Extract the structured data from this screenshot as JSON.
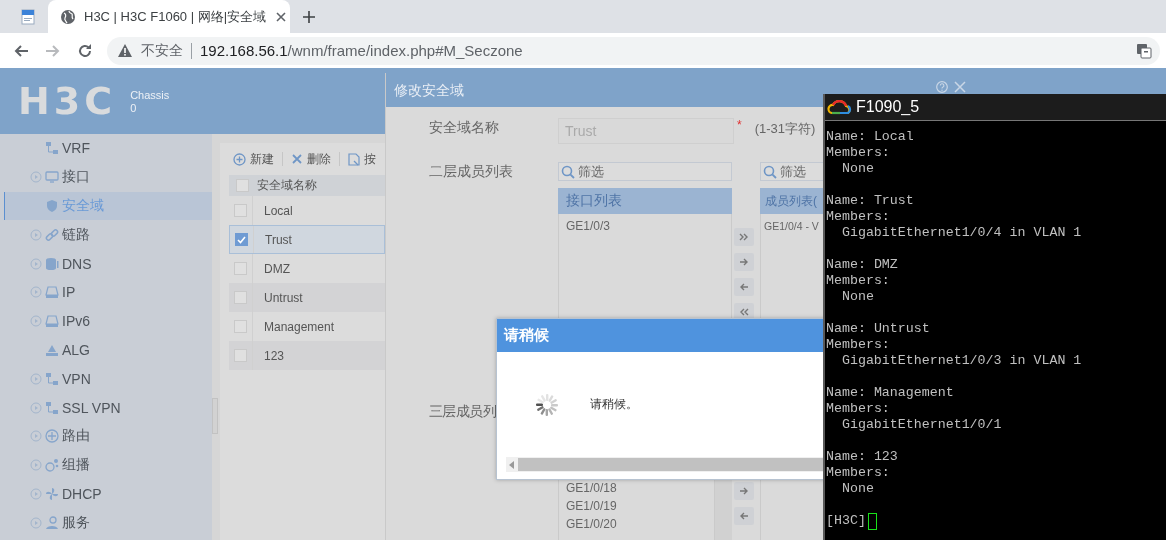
{
  "browser": {
    "tabs": [
      {
        "kind": "pinned",
        "selected": false
      },
      {
        "kind": "page",
        "title": "H3C | H3C F1060 | 网络|安全域",
        "selected": true
      }
    ],
    "nav": [
      {
        "kind": "back",
        "disabled": false
      },
      {
        "kind": "forward",
        "disabled": true
      },
      {
        "kind": "reload",
        "disabled": false
      }
    ],
    "address": {
      "security": "不安全",
      "url_host": "192.168.56.1",
      "url_path": "/wnm/frame/index.php#M_Seczone"
    }
  },
  "header": {
    "logo": "H3C",
    "device_label": "Chassis",
    "device_value": "0"
  },
  "sidebar": {
    "items": [
      {
        "label": "VRF",
        "expandable": false,
        "selected": false
      },
      {
        "label": "接口",
        "expandable": true,
        "selected": false
      },
      {
        "label": "安全域",
        "expandable": false,
        "selected": true
      },
      {
        "label": "链路",
        "expandable": true,
        "selected": false
      },
      {
        "label": "DNS",
        "expandable": true,
        "selected": false
      },
      {
        "label": "IP",
        "expandable": true,
        "selected": false
      },
      {
        "label": "IPv6",
        "expandable": true,
        "selected": false
      },
      {
        "label": "ALG",
        "expandable": false,
        "selected": false
      },
      {
        "label": "VPN",
        "expandable": true,
        "selected": false
      },
      {
        "label": "SSL VPN",
        "expandable": true,
        "selected": false
      },
      {
        "label": "路由",
        "expandable": true,
        "selected": false
      },
      {
        "label": "组播",
        "expandable": true,
        "selected": false
      },
      {
        "label": "DHCP",
        "expandable": true,
        "selected": false
      },
      {
        "label": "服务",
        "expandable": true,
        "selected": false
      }
    ]
  },
  "zone_list": {
    "toolbar": [
      {
        "kind": "add",
        "label": "新建"
      },
      {
        "kind": "delete",
        "label": "删除"
      },
      {
        "kind": "page",
        "label": "按"
      }
    ],
    "header": {
      "label": "安全域名称",
      "checked": false
    },
    "rows": [
      {
        "name": "Local",
        "checked": false,
        "selected": false
      },
      {
        "name": "Trust",
        "checked": true,
        "selected": true
      },
      {
        "name": "DMZ",
        "checked": false,
        "selected": false
      },
      {
        "name": "Untrust",
        "checked": false,
        "selected": false
      },
      {
        "name": "Management",
        "checked": false,
        "selected": false
      },
      {
        "name": "123",
        "checked": false,
        "selected": false
      }
    ]
  },
  "edit_dialog": {
    "title": "修改安全域",
    "name_label": "安全域名称",
    "name_value": "Trust",
    "name_disabled": true,
    "required_mark": "*",
    "name_hint": "(1-31字符)",
    "layer2": {
      "label": "二层成员列表",
      "filter_placeholder": "筛选",
      "available_header": "接口列表",
      "available": [
        "GE1/0/3"
      ],
      "member_filter_placeholder": "筛选",
      "member_header": "成员列表(",
      "members": [
        "GE1/0/4 - V"
      ]
    },
    "layer3": {
      "label": "三层成员列",
      "available": [
        "GE1/0/18",
        "GE1/0/19",
        "GE1/0/20"
      ]
    }
  },
  "wait_dialog": {
    "title": "请稍候",
    "message": "请稍候。"
  },
  "terminal": {
    "title": "F1090_5",
    "zones": [
      {
        "name": "Name: Local",
        "members_label": "Members:",
        "member": "None"
      },
      {
        "name": "Name: Trust",
        "members_label": "Members:",
        "member": "GigabitEthernet1/0/4 in VLAN 1"
      },
      {
        "name": "Name: DMZ",
        "members_label": "Members:",
        "member": "None"
      },
      {
        "name": "Name: Untrust",
        "members_label": "Members:",
        "member": "GigabitEthernet1/0/3 in VLAN 1"
      },
      {
        "name": "Name: Management",
        "members_label": "Members:",
        "member": "GigabitEthernet1/0/1"
      },
      {
        "name": "Name: 123",
        "members_label": "Members:",
        "member": "None"
      }
    ],
    "prompt": "[H3C]"
  }
}
